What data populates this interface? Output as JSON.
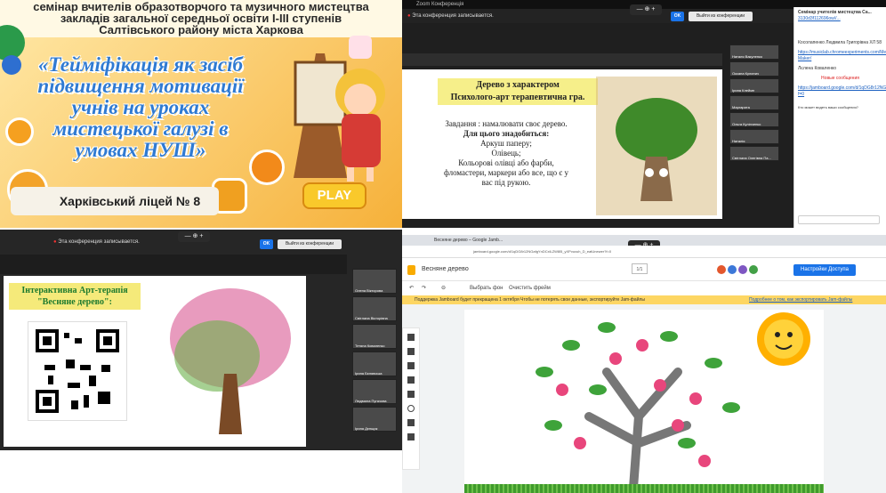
{
  "banner": {
    "header_lines": [
      "семінар вчителів образотворчого та музичного мистецтва",
      "закладів загальної середньої освіти І-ІІІ ступенів",
      "Салтівського району міста Харкова"
    ],
    "title_lines": [
      "«Тейміфікація як засіб",
      "підвищення мотивації",
      "учнів на уроках",
      "мистецької галузі в",
      "умовах НУШ»"
    ],
    "school": "Харківський ліцей № 8",
    "play": "PLAY"
  },
  "zoom1": {
    "window_title": "Zoom Конференція",
    "record_notice": "Эта конференция записывается.",
    "ok": "OK",
    "leave": "Выйти из конференции",
    "slide_title_lines": [
      "Дерево з характером",
      "Психолого-арт терапевтична гра."
    ],
    "slide_body_lines": [
      "Завдання : намалювати своє дерево.",
      "Для цього знадобиться:",
      "Аркуш паперу;",
      "Олівець;",
      "Кольорові олівці або фарби,",
      "фломастери, маркери або все, що є у",
      "вас під рукою."
    ],
    "participants": [
      "Наталя Вакуленко",
      "Оксана Кулинич",
      "Ірина Клеймн",
      "Маргарита",
      "Ольга Кулінченко",
      "Наталія",
      "Світлана Олегівна Па..."
    ],
    "chat": {
      "title": "Семінар учителів мистецтва Са...",
      "link_top": "3130d3f112696ow//...",
      "author1": "Косолапенко Людмила Григорівна ХЛ 58",
      "link1": "https://musiclab.chromeexperiments.com/Melody-Maker/",
      "author2": "Лєлена Коваленко",
      "new_label": "Новые сообщения",
      "link2": "https://jamboard.google.com/d/1qDG8r12NGafgYnDCxlLZW8l5_yXPvuxuh_D_eatUnewer?f=0",
      "hint": "Кто может видеть ваши сообщения?"
    }
  },
  "zoom2": {
    "record_notice": "Эта конференция записывается.",
    "ok": "OK",
    "leave": "Выйти из конференции",
    "slide_title_lines": [
      "Інтерактивна Арт-терапія",
      "\"Весняне дерево\":"
    ],
    "participants": [
      "Олена Вікторова",
      "Світлана Вікторівна",
      "Тетяна Коваленко",
      "Ірина Бєлявська",
      "Людмила Пугачова",
      "Ірина Дєнщик"
    ]
  },
  "jamboard": {
    "tab": "Весняне дерево – Google Jamb...",
    "url": "jamboard.google.com/d/1qDG8r12NGafgYnDCxlLZW8l5_yXPvuxuh_D_eatUnewer?f=0",
    "board_name": "Весняне дерево",
    "share": "Настройки Доступа",
    "set_bg": "Выбрать фон",
    "clear": "Очистить фрейм",
    "banner_text": "Поддержка Jamboard будет прекращена 1 октября   Чтобы не потерять свои данные, экспортируйте Jam-файлы",
    "banner_link": "Подробнее о том, как экспортировать Jam-файлы",
    "frame_counter": "1/1"
  }
}
